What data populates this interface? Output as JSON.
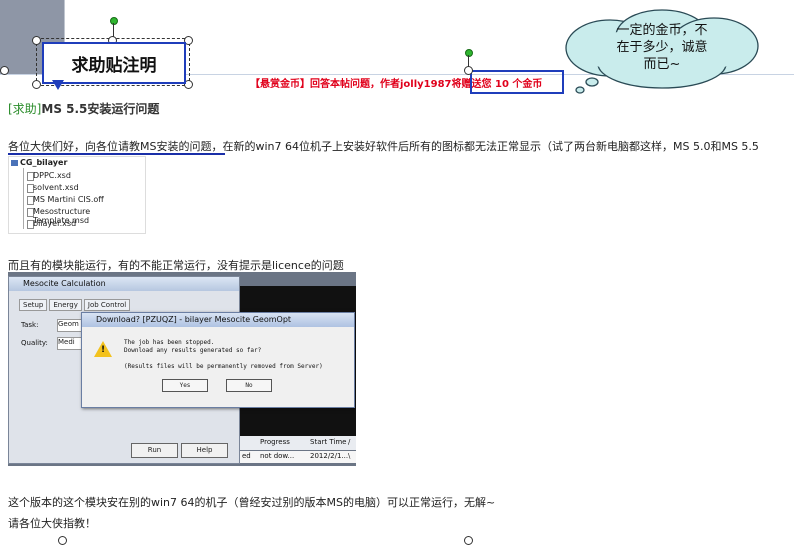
{
  "callout": {
    "label": "求助贴注明"
  },
  "reward_banner": {
    "text": "【悬赏金币】回答本帖问题，作者jolly1987将赠送您 10 个金币"
  },
  "cloud_note": {
    "line1": "一定的金币，不",
    "line2": "在于多少，诚意",
    "line3": "而已~"
  },
  "post": {
    "tag": "[求助]",
    "title": "MS 5.5安装运行问题",
    "paragraph1": "各位大侠们好，向各位请教MS安装的问题，在新的win7 64位机子上安装好软件后所有的图标都无法正常显示（试了两台新电脑都这样，MS 5.0和MS 5.5",
    "paragraph2": "而且有的模块能运行，有的不能正常运行，没有提示是licence的问题",
    "paragraph3": "这个版本的这个模块安在别的win7 64的机子（曾经安过别的版本MS的电脑）可以正常运行，无解~",
    "paragraph4": "请各位大侠指教！"
  },
  "file_tree": {
    "root": "CG_bilayer",
    "items": [
      "DPPC.xsd",
      "solvent.xsd",
      "MS Martini CIS.off",
      "Mesostructure Template.msd",
      "bilayer.xsd"
    ]
  },
  "mesocite_window": {
    "title": "Mesocite Calculation",
    "tabs": [
      "Setup",
      "Energy",
      "Job Control"
    ],
    "task_label": "Task:",
    "task_value": "Geom",
    "quality_label": "Quality:",
    "quality_value": "Medi",
    "run_button": "Run",
    "help_button": "Help"
  },
  "download_dialog": {
    "title": "Download? [PZUQZ] - bilayer Mesocite GeomOpt",
    "line1": "The job has been stopped.",
    "line2": "Download any results generated so far?",
    "line3": "(Results files will be permanently removed from Server)",
    "yes": "Yes",
    "no": "No"
  },
  "job_table": {
    "columns": [
      "Progress",
      "Start Time",
      "/"
    ],
    "row": [
      "ed",
      "not dow...",
      "2012/2/1...",
      "\\"
    ]
  }
}
